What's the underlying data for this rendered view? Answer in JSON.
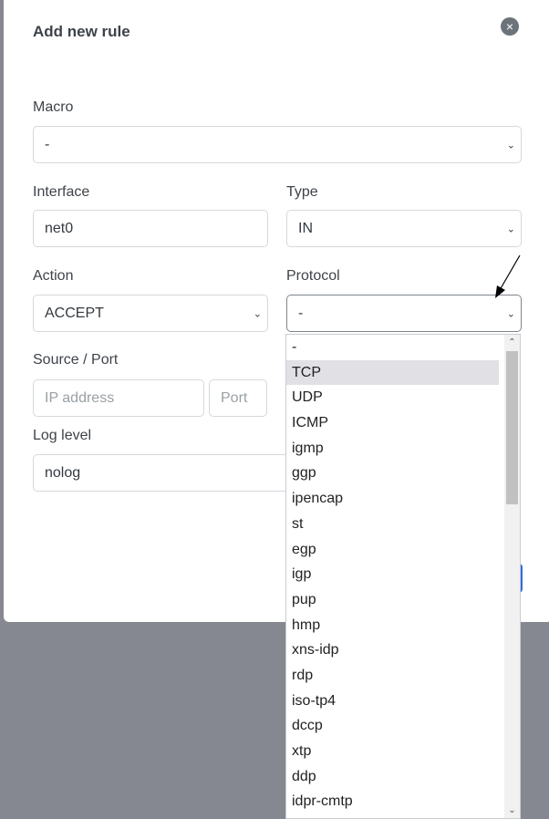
{
  "modal": {
    "title": "Add new rule"
  },
  "labels": {
    "macro": "Macro",
    "interface": "Interface",
    "type": "Type",
    "action": "Action",
    "protocol": "Protocol",
    "source": "Source / Port",
    "log": "Log level"
  },
  "fields": {
    "macro": "-",
    "interface": "net0",
    "type": "IN",
    "action": "ACCEPT",
    "protocol": "-",
    "ip_placeholder": "IP address",
    "port_placeholder": "Port",
    "log": "nolog"
  },
  "icons": {
    "close": "×",
    "chevron": "⌄",
    "scroll_up": "⌃",
    "scroll_down": "⌄"
  },
  "dropdown": {
    "highlighted": "TCP",
    "options": [
      "-",
      "TCP",
      "UDP",
      "ICMP",
      "igmp",
      "ggp",
      "ipencap",
      "st",
      "egp",
      "igp",
      "pup",
      "hmp",
      "xns-idp",
      "rdp",
      "iso-tp4",
      "dccp",
      "xtp",
      "ddp",
      "idpr-cmtp"
    ]
  },
  "colors": {
    "accent": "#2f6fd6",
    "backdrop": "#868891",
    "highlight": "#e0e0e5"
  }
}
